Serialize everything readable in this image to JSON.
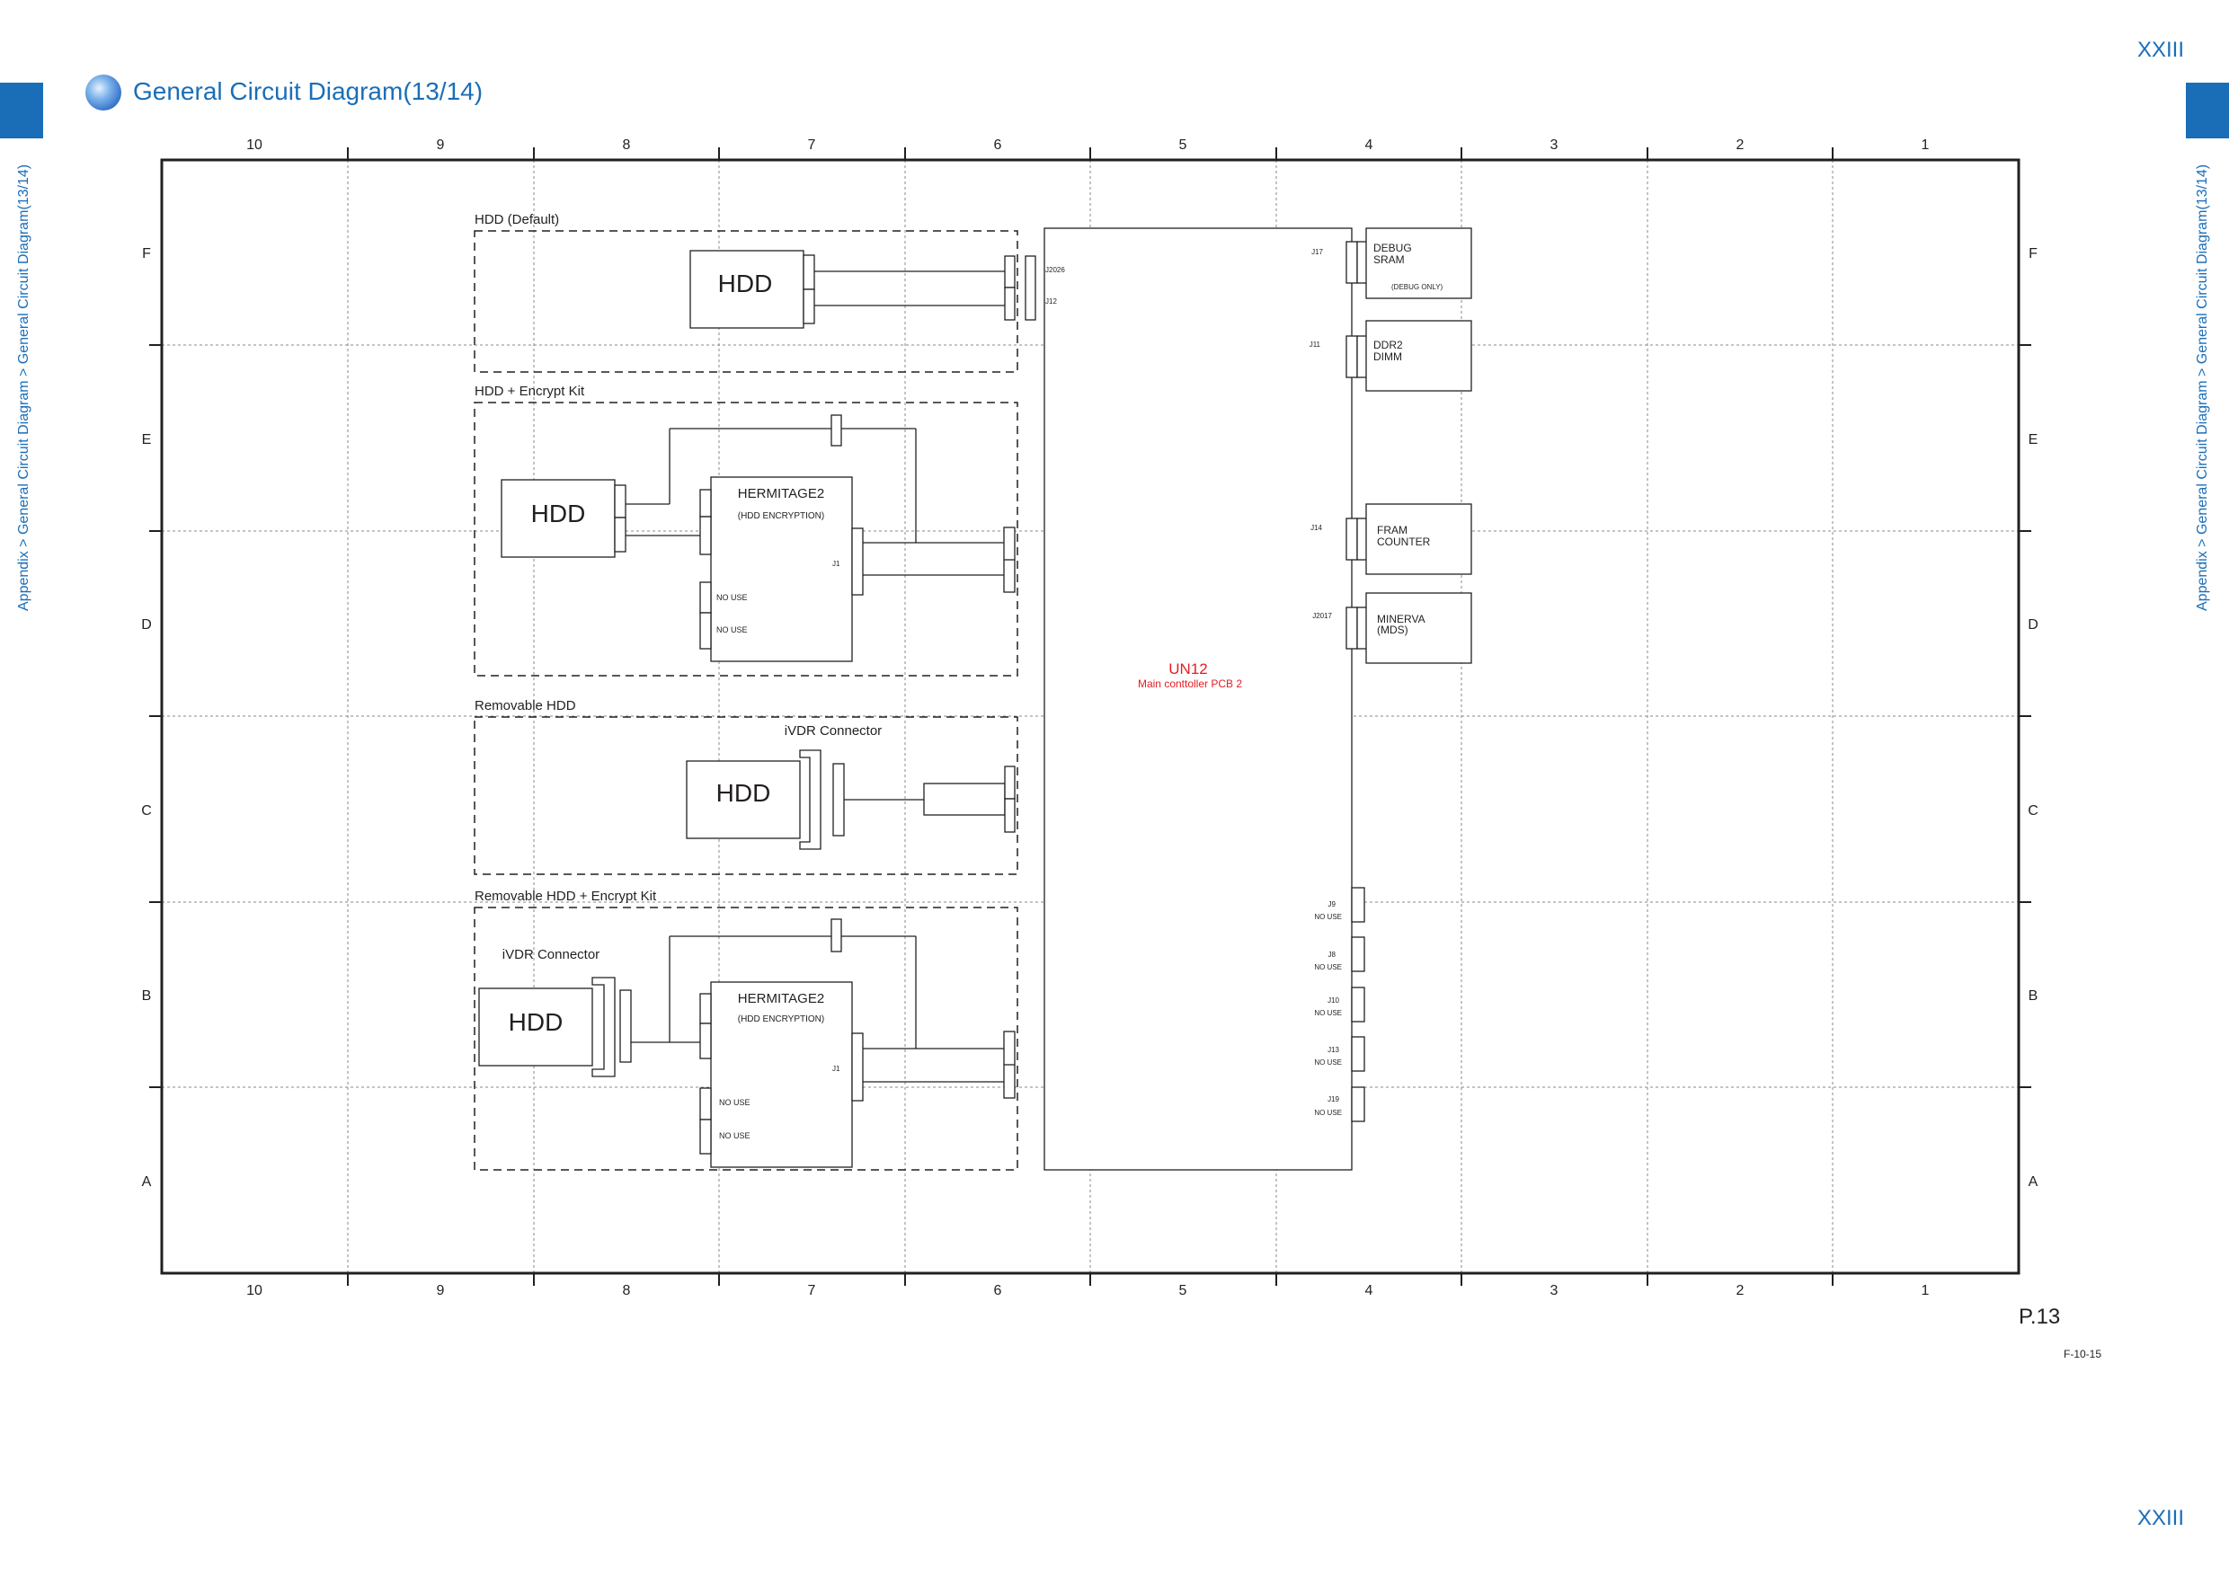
{
  "page": {
    "number": "XXIII",
    "title": "General Circuit Diagram(13/14)",
    "breadcrumb": "Appendix > General Circuit Diagram > General Circuit Diagram(13/14)",
    "page_ref": "P.13",
    "figure_ref": "F-10-15"
  },
  "grid": {
    "columns": [
      "10",
      "9",
      "8",
      "7",
      "6",
      "5",
      "4",
      "3",
      "2",
      "1"
    ],
    "rows": [
      "F",
      "E",
      "D",
      "C",
      "B",
      "A"
    ]
  },
  "sections": {
    "hdd_default": "HDD (Default)",
    "hdd_encrypt": "HDD + Encrypt Kit",
    "removable_hdd": "Removable HDD",
    "removable_encrypt": "Removable HDD + Encrypt Kit"
  },
  "components": {
    "hdd": "HDD",
    "hermitage": "HERMITAGE2",
    "hermitage_sub": "(HDD ENCRYPTION)",
    "ivdr": "iVDR Connector",
    "no_use": "NO USE",
    "j1": "J1",
    "un12": "UN12",
    "un12_sub": "Main conttoller PCB 2",
    "debug_sram": [
      "DEBUG",
      "SRAM"
    ],
    "debug_only": "(DEBUG ONLY)",
    "ddr2_dimm": [
      "DDR2",
      "DIMM"
    ],
    "fram_counter": [
      "FRAM",
      "COUNTER"
    ],
    "minerva": [
      "MINERVA",
      "(MDS)"
    ]
  },
  "jacks": {
    "j2026": "J2026",
    "j12": "J12",
    "j17": "J17",
    "j11": "J11",
    "j14": "J14",
    "j2017": "J2017",
    "j9": "J9",
    "j8": "J8",
    "j10": "J10",
    "j13": "J13",
    "j19": "J19"
  },
  "colors": {
    "accent_blue": "#1a6eb8",
    "highlight_red": "#e31e24",
    "line": "#231f20"
  }
}
